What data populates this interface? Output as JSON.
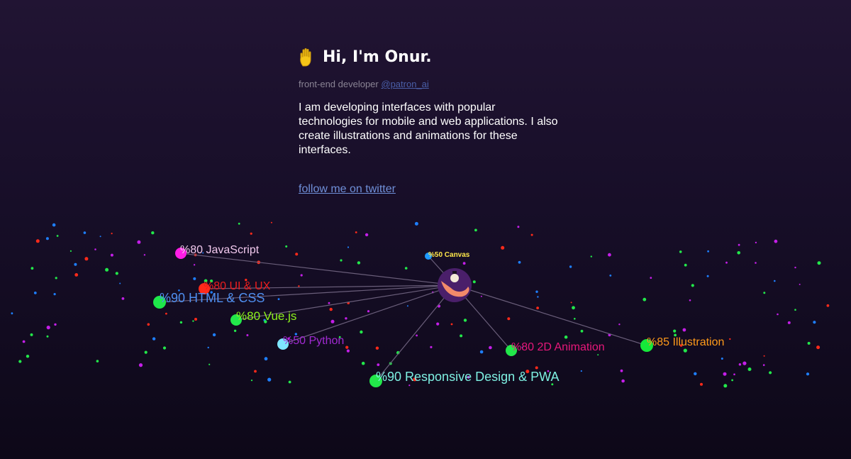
{
  "intro": {
    "title": "Hi, I'm Onur.",
    "role": "front-end developer",
    "handle": "@patron_ai",
    "bio": "I am developing interfaces with popular technologies for mobile and web applications. I also create illustrations and animations for these interfaces.",
    "follow_link": "follow me on twitter"
  },
  "skills": [
    {
      "label": "%80 JavaScript",
      "node_color": "#ff1ee6",
      "label_color": "#f2c9ee"
    },
    {
      "label": "%80 UI & UX",
      "node_color": "#ff2a1a",
      "label_color": "#ee1c1c"
    },
    {
      "label": "%90 HTML & CSS",
      "node_color": "#1ee84a",
      "label_color": "#4f8ff0"
    },
    {
      "label": "%80 Vue.js",
      "node_color": "#22e84a",
      "label_color": "#8cf21c"
    },
    {
      "label": "%50 Python",
      "node_color": "#7ee6ff",
      "label_color": "#a12ad2"
    },
    {
      "label": "%90 Responsive Design & PWA",
      "node_color": "#22e84a",
      "label_color": "#7ef0e2"
    },
    {
      "label": "%80 2D Animation",
      "node_color": "#22e84a",
      "label_color": "#e8187a"
    },
    {
      "label": "%85 Illustration",
      "node_color": "#16e83a",
      "label_color": "#ff9a1a"
    },
    {
      "label": "%50 Canvas",
      "node_color": "#1e9aff",
      "label_color": "#ffe84a"
    }
  ],
  "hub": {
    "icon": "avatar-icon",
    "background": "#4a1f6a",
    "accent": "#f28a6a"
  },
  "colors": {
    "edge": "#6a5e7a",
    "particles": [
      "#1e7fff",
      "#ff2a1a",
      "#c41ee8",
      "#22e84a"
    ]
  }
}
